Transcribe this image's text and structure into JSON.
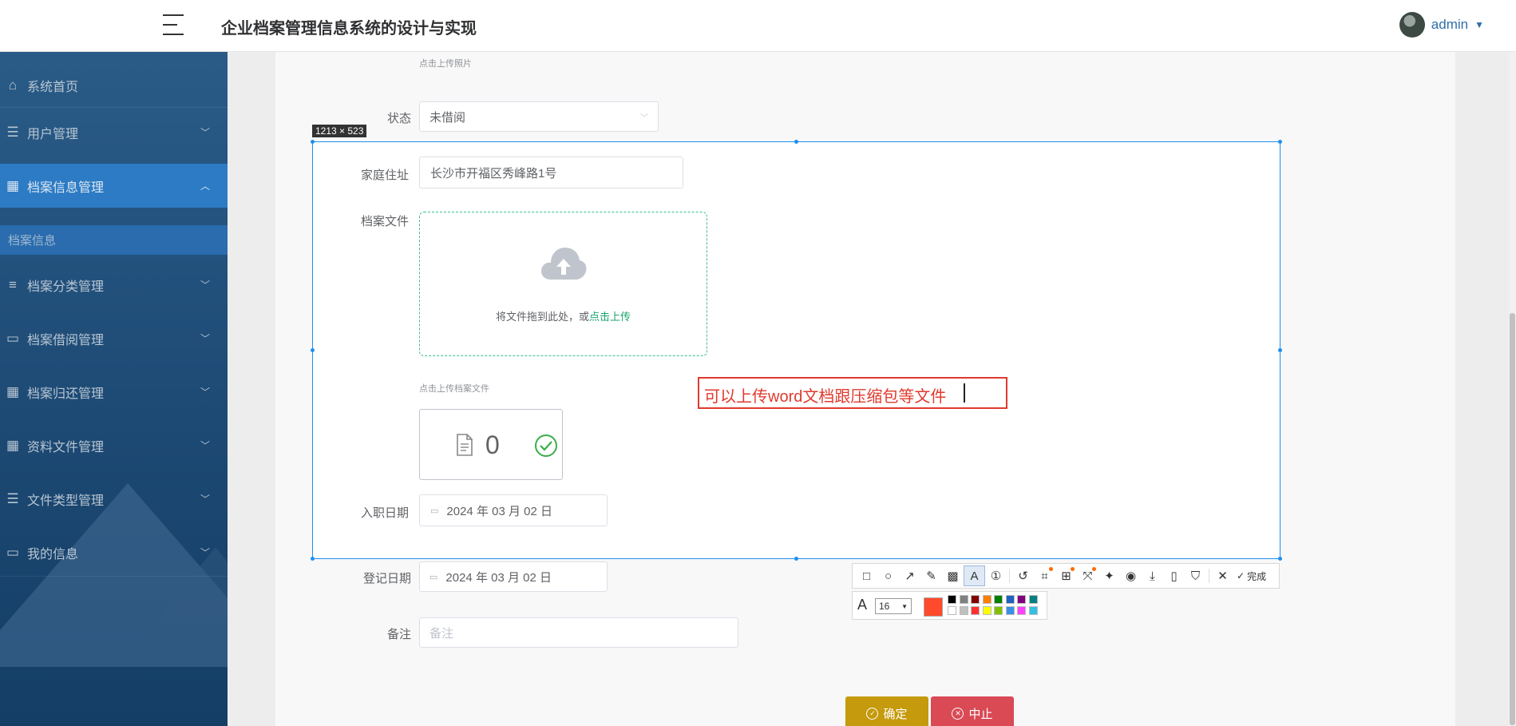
{
  "header": {
    "title": "企业档案管理信息系统的设计与实现",
    "user": "admin"
  },
  "sidebar": {
    "items": [
      {
        "label": "系统首页",
        "icon": "home-icon"
      },
      {
        "label": "用户管理",
        "icon": "list-icon"
      },
      {
        "label": "档案信息管理",
        "icon": "grid-icon",
        "active": true
      },
      {
        "label": "档案分类管理",
        "icon": "sliders-icon"
      },
      {
        "label": "档案借阅管理",
        "icon": "monitor-icon"
      },
      {
        "label": "档案归还管理",
        "icon": "grid-icon"
      },
      {
        "label": "资料文件管理",
        "icon": "apps-icon"
      },
      {
        "label": "文件类型管理",
        "icon": "list-icon"
      },
      {
        "label": "我的信息",
        "icon": "card-icon"
      }
    ],
    "submenu": {
      "label": "档案信息"
    }
  },
  "form_bg": {
    "photo_hint": "点击上传照片",
    "status_label": "状态",
    "status_value": "未借阅",
    "register_date_label": "登记日期",
    "register_date_value": "2024 年 03 月 02 日",
    "remark_label": "备注",
    "remark_placeholder": "备注",
    "confirm_button": "确定",
    "cancel_button": "中止"
  },
  "capture": {
    "size_label": "1213 × 523",
    "address_label": "家庭住址",
    "address_value": "长沙市开福区秀峰路1号",
    "file_label": "档案文件",
    "upload_text": "将文件拖到此处，或",
    "upload_link": "点击上传",
    "file_hint": "点击上传档案文件",
    "file_count": "0",
    "entry_date_label": "入职日期",
    "entry_date_value": "2024 年 03 月 02 日",
    "annotation_text": "可以上传word文档跟压缩包等文件"
  },
  "screenshot_toolbar": {
    "tools": [
      "rectangle-icon",
      "ellipse-icon",
      "arrow-icon",
      "pencil-icon",
      "mosaic-icon",
      "text-icon",
      "number-icon",
      "undo-icon",
      "ocr-icon",
      "translate-icon",
      "scroll-capture-icon",
      "pin-icon",
      "record-icon",
      "download-icon",
      "phone-icon",
      "bookmark-icon",
      "close-icon"
    ],
    "done_label": "完成",
    "font_size": "16",
    "current_color": "#ff4a2c",
    "palette_top": [
      "#000000",
      "#808080",
      "#800000",
      "#ff8000",
      "#008000",
      "#2060c0",
      "#800080",
      "#008080"
    ],
    "palette_bottom": [
      "#ffffff",
      "#c0c0c0",
      "#ff3030",
      "#ffff00",
      "#80c000",
      "#3a8ee6",
      "#ff40ff",
      "#30c0e0"
    ]
  }
}
